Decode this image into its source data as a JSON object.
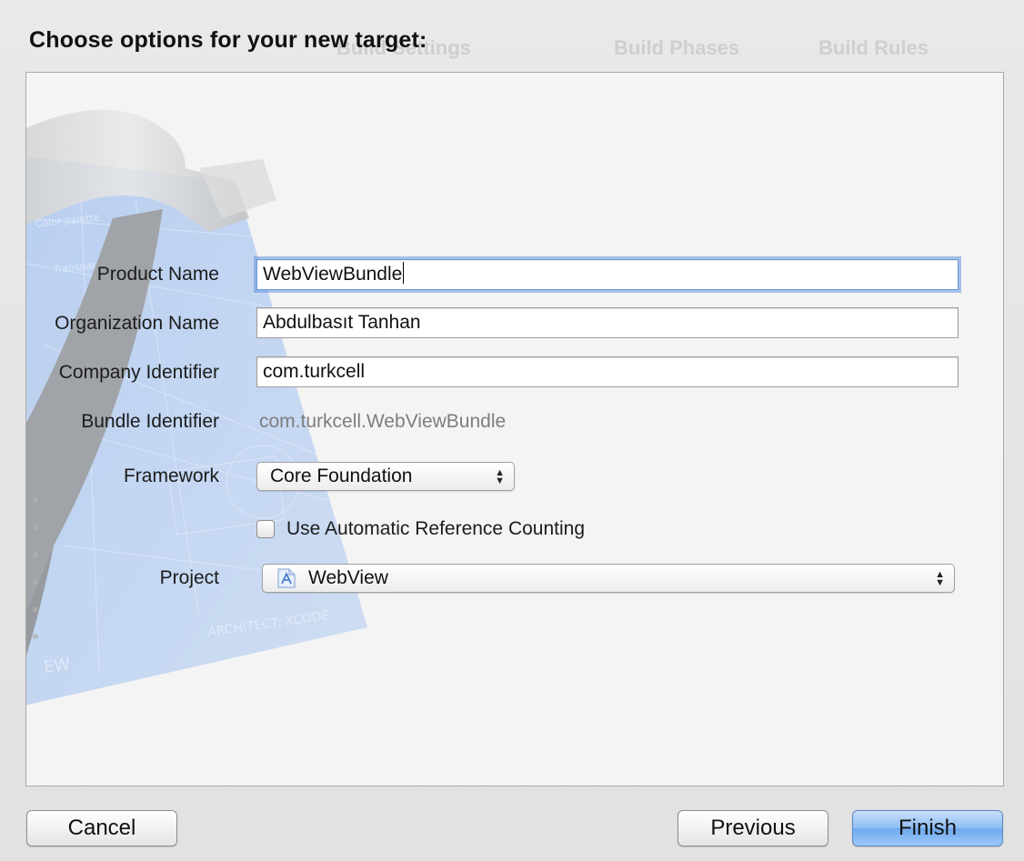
{
  "dialog": {
    "title": "Choose options for your new target:"
  },
  "background": {
    "ghost_tabs": [
      "Build Settings",
      "Build Phases",
      "Build Rules"
    ]
  },
  "form": {
    "product_name": {
      "label": "Product Name",
      "value": "WebViewBundle"
    },
    "organization_name": {
      "label": "Organization Name",
      "value": "Abdulbasıt Tanhan"
    },
    "company_identifier": {
      "label": "Company Identifier",
      "value": "com.turkcell"
    },
    "bundle_identifier": {
      "label": "Bundle Identifier",
      "value": "com.turkcell.WebViewBundle"
    },
    "framework": {
      "label": "Framework",
      "selected": "Core Foundation"
    },
    "arc": {
      "label": "Use Automatic Reference Counting",
      "checked": false
    },
    "project": {
      "label": "Project",
      "selected": "WebView",
      "icon": "xcode-project-icon"
    }
  },
  "buttons": {
    "cancel": "Cancel",
    "previous": "Previous",
    "finish": "Finish"
  },
  "colors": {
    "accent": "#6ea8ef",
    "focus_ring": "#6396dc",
    "blueprint": "#4f86d8"
  }
}
